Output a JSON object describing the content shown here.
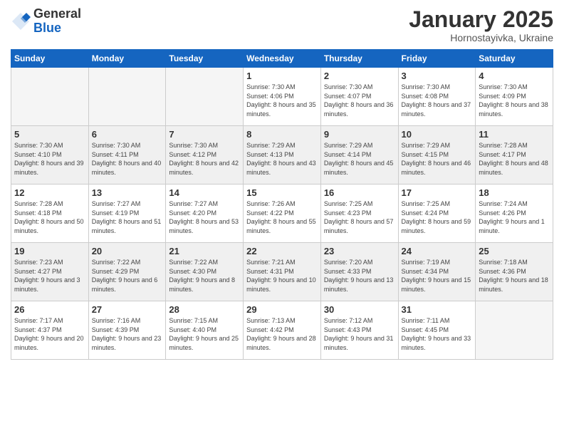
{
  "logo": {
    "general": "General",
    "blue": "Blue"
  },
  "header": {
    "month": "January 2025",
    "location": "Hornostayivka, Ukraine"
  },
  "days_of_week": [
    "Sunday",
    "Monday",
    "Tuesday",
    "Wednesday",
    "Thursday",
    "Friday",
    "Saturday"
  ],
  "weeks": [
    [
      {
        "num": "",
        "info": ""
      },
      {
        "num": "",
        "info": ""
      },
      {
        "num": "",
        "info": ""
      },
      {
        "num": "1",
        "info": "Sunrise: 7:30 AM\nSunset: 4:06 PM\nDaylight: 8 hours and 35 minutes."
      },
      {
        "num": "2",
        "info": "Sunrise: 7:30 AM\nSunset: 4:07 PM\nDaylight: 8 hours and 36 minutes."
      },
      {
        "num": "3",
        "info": "Sunrise: 7:30 AM\nSunset: 4:08 PM\nDaylight: 8 hours and 37 minutes."
      },
      {
        "num": "4",
        "info": "Sunrise: 7:30 AM\nSunset: 4:09 PM\nDaylight: 8 hours and 38 minutes."
      }
    ],
    [
      {
        "num": "5",
        "info": "Sunrise: 7:30 AM\nSunset: 4:10 PM\nDaylight: 8 hours and 39 minutes."
      },
      {
        "num": "6",
        "info": "Sunrise: 7:30 AM\nSunset: 4:11 PM\nDaylight: 8 hours and 40 minutes."
      },
      {
        "num": "7",
        "info": "Sunrise: 7:30 AM\nSunset: 4:12 PM\nDaylight: 8 hours and 42 minutes."
      },
      {
        "num": "8",
        "info": "Sunrise: 7:29 AM\nSunset: 4:13 PM\nDaylight: 8 hours and 43 minutes."
      },
      {
        "num": "9",
        "info": "Sunrise: 7:29 AM\nSunset: 4:14 PM\nDaylight: 8 hours and 45 minutes."
      },
      {
        "num": "10",
        "info": "Sunrise: 7:29 AM\nSunset: 4:15 PM\nDaylight: 8 hours and 46 minutes."
      },
      {
        "num": "11",
        "info": "Sunrise: 7:28 AM\nSunset: 4:17 PM\nDaylight: 8 hours and 48 minutes."
      }
    ],
    [
      {
        "num": "12",
        "info": "Sunrise: 7:28 AM\nSunset: 4:18 PM\nDaylight: 8 hours and 50 minutes."
      },
      {
        "num": "13",
        "info": "Sunrise: 7:27 AM\nSunset: 4:19 PM\nDaylight: 8 hours and 51 minutes."
      },
      {
        "num": "14",
        "info": "Sunrise: 7:27 AM\nSunset: 4:20 PM\nDaylight: 8 hours and 53 minutes."
      },
      {
        "num": "15",
        "info": "Sunrise: 7:26 AM\nSunset: 4:22 PM\nDaylight: 8 hours and 55 minutes."
      },
      {
        "num": "16",
        "info": "Sunrise: 7:25 AM\nSunset: 4:23 PM\nDaylight: 8 hours and 57 minutes."
      },
      {
        "num": "17",
        "info": "Sunrise: 7:25 AM\nSunset: 4:24 PM\nDaylight: 8 hours and 59 minutes."
      },
      {
        "num": "18",
        "info": "Sunrise: 7:24 AM\nSunset: 4:26 PM\nDaylight: 9 hours and 1 minute."
      }
    ],
    [
      {
        "num": "19",
        "info": "Sunrise: 7:23 AM\nSunset: 4:27 PM\nDaylight: 9 hours and 3 minutes."
      },
      {
        "num": "20",
        "info": "Sunrise: 7:22 AM\nSunset: 4:29 PM\nDaylight: 9 hours and 6 minutes."
      },
      {
        "num": "21",
        "info": "Sunrise: 7:22 AM\nSunset: 4:30 PM\nDaylight: 9 hours and 8 minutes."
      },
      {
        "num": "22",
        "info": "Sunrise: 7:21 AM\nSunset: 4:31 PM\nDaylight: 9 hours and 10 minutes."
      },
      {
        "num": "23",
        "info": "Sunrise: 7:20 AM\nSunset: 4:33 PM\nDaylight: 9 hours and 13 minutes."
      },
      {
        "num": "24",
        "info": "Sunrise: 7:19 AM\nSunset: 4:34 PM\nDaylight: 9 hours and 15 minutes."
      },
      {
        "num": "25",
        "info": "Sunrise: 7:18 AM\nSunset: 4:36 PM\nDaylight: 9 hours and 18 minutes."
      }
    ],
    [
      {
        "num": "26",
        "info": "Sunrise: 7:17 AM\nSunset: 4:37 PM\nDaylight: 9 hours and 20 minutes."
      },
      {
        "num": "27",
        "info": "Sunrise: 7:16 AM\nSunset: 4:39 PM\nDaylight: 9 hours and 23 minutes."
      },
      {
        "num": "28",
        "info": "Sunrise: 7:15 AM\nSunset: 4:40 PM\nDaylight: 9 hours and 25 minutes."
      },
      {
        "num": "29",
        "info": "Sunrise: 7:13 AM\nSunset: 4:42 PM\nDaylight: 9 hours and 28 minutes."
      },
      {
        "num": "30",
        "info": "Sunrise: 7:12 AM\nSunset: 4:43 PM\nDaylight: 9 hours and 31 minutes."
      },
      {
        "num": "31",
        "info": "Sunrise: 7:11 AM\nSunset: 4:45 PM\nDaylight: 9 hours and 33 minutes."
      },
      {
        "num": "",
        "info": ""
      }
    ]
  ]
}
